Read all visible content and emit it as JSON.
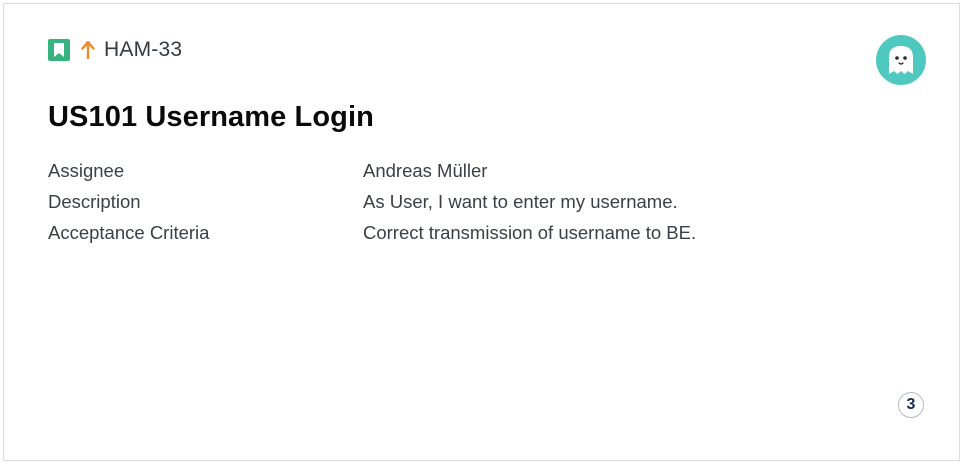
{
  "issue": {
    "type_icon": "story-bookmark-icon",
    "priority_icon": "priority-arrow-up-icon",
    "key": "HAM-33",
    "title": "US101 Username Login",
    "assignee_avatar": "ghost-avatar-icon",
    "story_points": "3"
  },
  "fields": [
    {
      "label": "Assignee",
      "value": "Andreas Müller"
    },
    {
      "label": "Description",
      "value": "As User, I want to enter my username."
    },
    {
      "label": "Acceptance Criteria",
      "value": "Correct transmission of username to BE."
    }
  ],
  "colors": {
    "story_green": "#36b37e",
    "priority_orange": "#f08a24",
    "avatar_teal": "#4fc9c0"
  }
}
